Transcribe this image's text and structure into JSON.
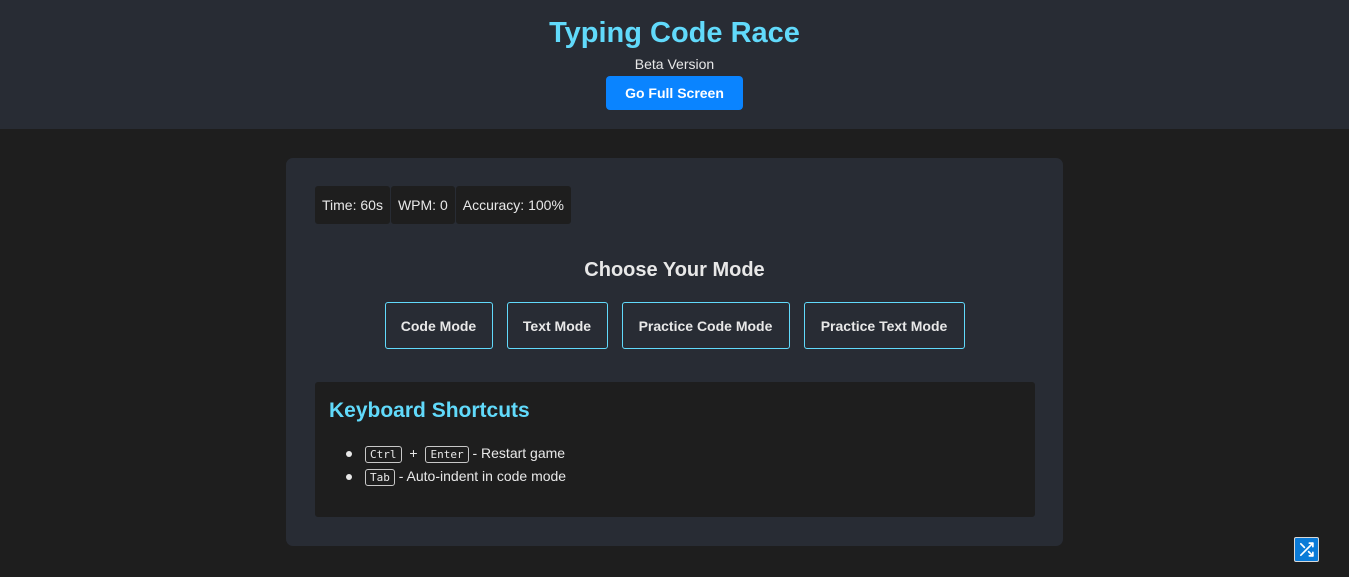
{
  "header": {
    "title": "Typing Code Race",
    "subtitle": "Beta Version",
    "fullscreen_label": "Go Full Screen"
  },
  "stats": {
    "time": "Time: 60s",
    "wpm": "WPM: 0",
    "accuracy": "Accuracy: 100%"
  },
  "mode_heading": "Choose Your Mode",
  "modes": [
    {
      "label": "Code Mode"
    },
    {
      "label": "Text Mode"
    },
    {
      "label": "Practice Code Mode"
    },
    {
      "label": "Practice Text Mode"
    }
  ],
  "shortcuts": {
    "title": "Keyboard Shortcuts",
    "items": [
      {
        "keys": [
          "Ctrl",
          "Enter"
        ],
        "joiner": "+",
        "description": "- Restart game"
      },
      {
        "keys": [
          "Tab"
        ],
        "description": "- Auto-indent in code mode"
      }
    ]
  },
  "icons": {
    "shuffle": "shuffle-icon"
  },
  "colors": {
    "accent": "#61dafb",
    "button": "#0a84ff",
    "header_bg": "#282c34",
    "page_bg": "#1e1e1e"
  }
}
